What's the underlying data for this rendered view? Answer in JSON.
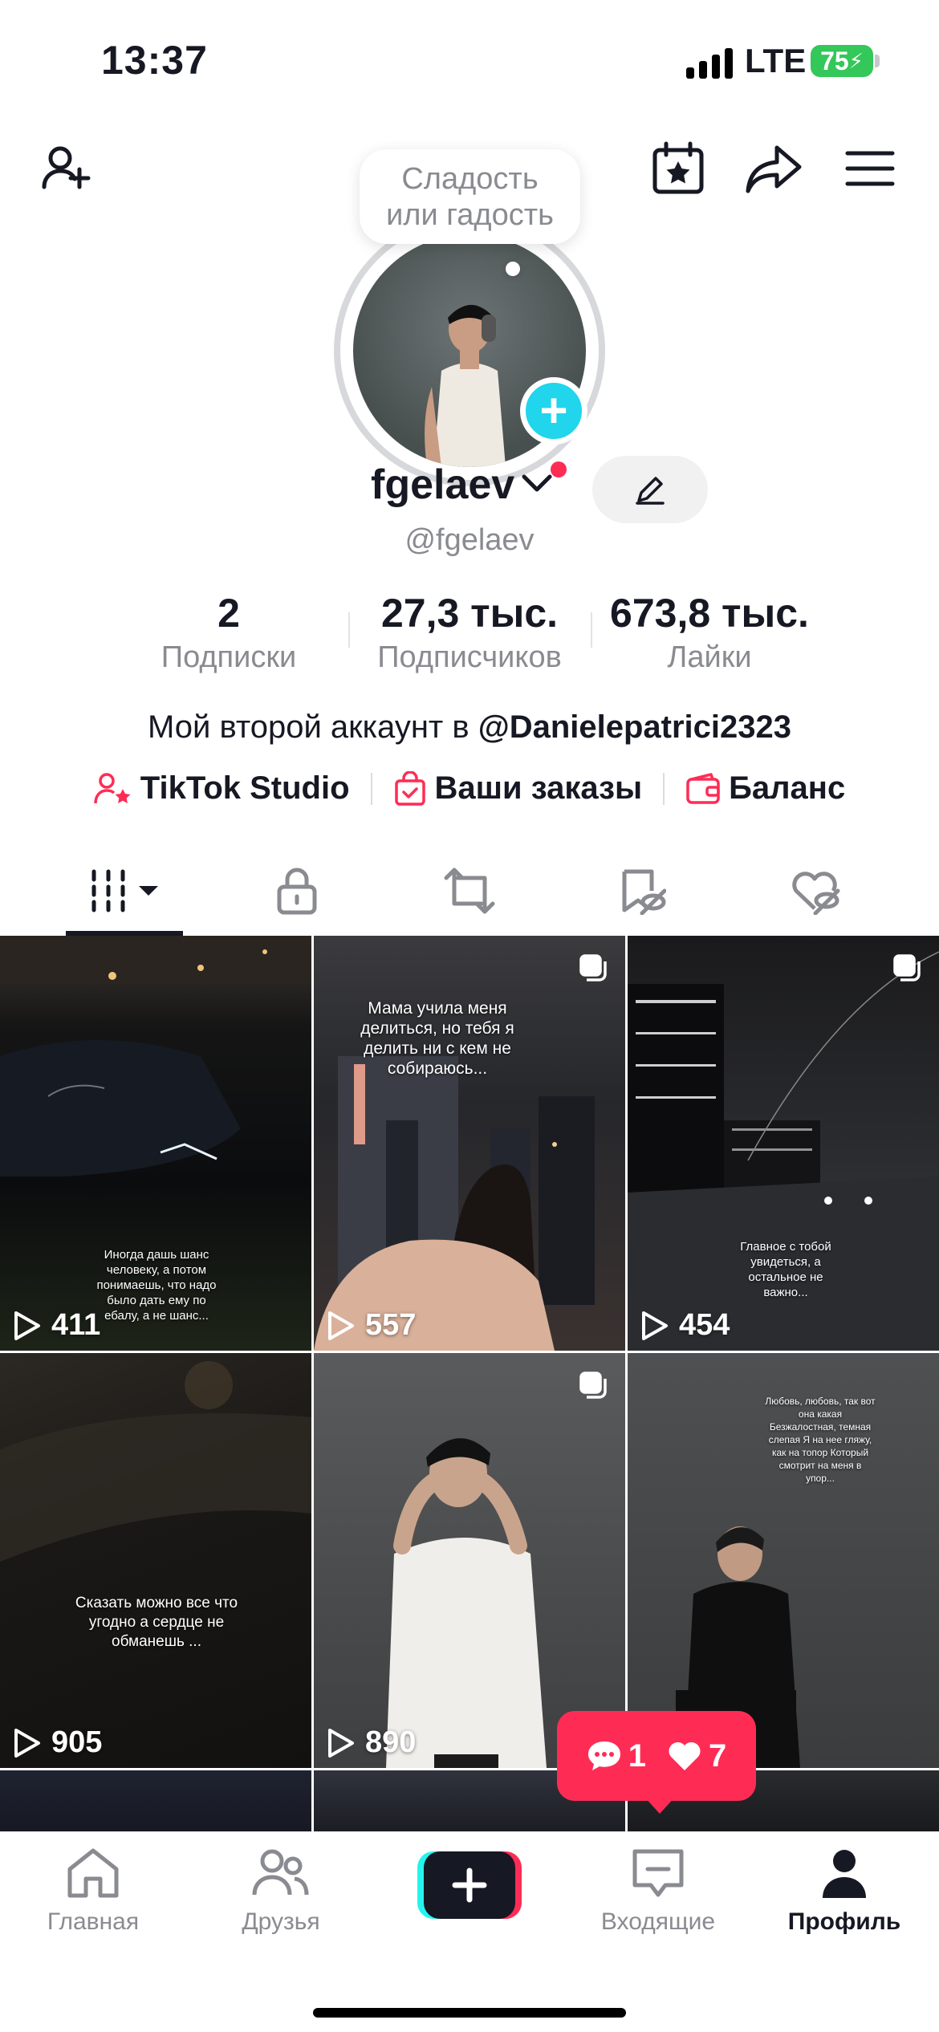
{
  "status_bar": {
    "time": "13:37",
    "network": "LTE",
    "battery": "75"
  },
  "tooltip_bubble": {
    "line1": "Сладость",
    "line2": "или гадость"
  },
  "profile": {
    "display_name": "fgelaev",
    "handle": "@fgelaev",
    "bio_prefix": "Мой второй аккаунт в ",
    "bio_mention": "@Danielepatrici2323"
  },
  "stats": [
    {
      "value": "2",
      "label": "Подписки"
    },
    {
      "value": "27,3 тыс.",
      "label": "Подписчиков"
    },
    {
      "value": "673,8 тыс.",
      "label": "Лайки"
    }
  ],
  "links": {
    "studio": "TikTok Studio",
    "orders": "Ваши заказы",
    "balance": "Баланс"
  },
  "tabs": [
    "videos-grid-icon",
    "lock-icon",
    "repost-icon",
    "favorites-hidden-icon",
    "liked-hidden-icon"
  ],
  "videos": [
    {
      "views": "411",
      "caption": "Иногда дашь шанс человеку, а потом понимаешь, что надо было дать ему по ебалу, а не шанс..."
    },
    {
      "views": "557",
      "caption": "Мама учила меня делиться, но тебя я делить ни с кем не собираюсь..."
    },
    {
      "views": "454",
      "caption": "Главное с тобой увидеться, а остальное не важно..."
    },
    {
      "views": "905",
      "caption": "Сказать можно все что угодно а сердце не обманешь ..."
    },
    {
      "views": "890",
      "caption": ""
    },
    {
      "views": "",
      "caption": "Любовь, любовь, так вот она какая Безжалостная, темная слепая Я на нее гляжу, как на топор Который смотрит на меня в упор..."
    }
  ],
  "notification": {
    "comments": "1",
    "likes": "7"
  },
  "nav": {
    "home": "Главная",
    "friends": "Друзья",
    "inbox": "Входящие",
    "profile": "Профиль"
  },
  "colors": {
    "accent": "#fe2c55",
    "teal": "#20d5ec",
    "battery": "#34c759"
  }
}
